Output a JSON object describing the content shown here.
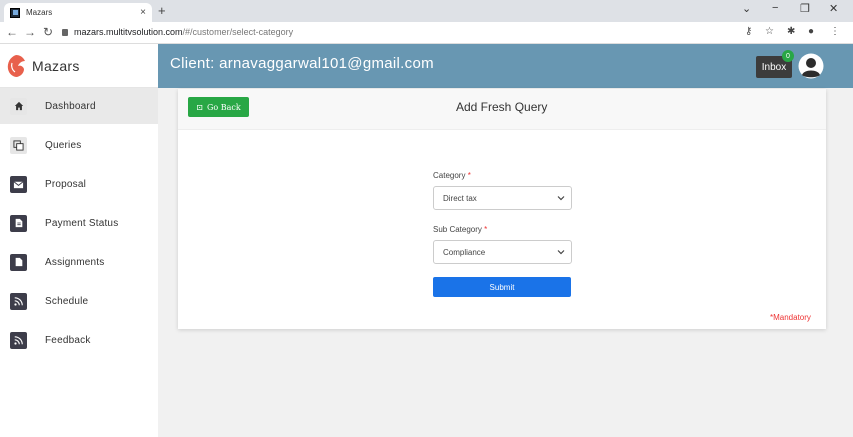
{
  "browser": {
    "tab_title": "Mazars",
    "tab_close": "×",
    "new_tab": "+",
    "url_host": "mazars.multitvsolution.com",
    "url_path": "/#/customer/select-category",
    "win_minimize": "−",
    "win_restore": "❐",
    "win_close": "✕",
    "win_dropdown": "⌄"
  },
  "brand": {
    "name": "Mazars",
    "logo_color": "#e8604c"
  },
  "header": {
    "client_label": "Client: arnavaggarwal101@gmail.com",
    "inbox_label": "Inbox",
    "inbox_count": "0",
    "bar_color": "#6897b2"
  },
  "sidebar": {
    "items": [
      {
        "label": "Dashboard",
        "icon": "home-icon",
        "active": true
      },
      {
        "label": "Queries",
        "icon": "copy-icon",
        "active": false
      },
      {
        "label": "Proposal",
        "icon": "mail-icon",
        "active": false
      },
      {
        "label": "Payment Status",
        "icon": "file-icon",
        "active": false
      },
      {
        "label": "Assignments",
        "icon": "file-icon",
        "active": false
      },
      {
        "label": "Schedule",
        "icon": "rss-icon",
        "active": false
      },
      {
        "label": "Feedback",
        "icon": "rss-icon",
        "active": false
      }
    ]
  },
  "form": {
    "go_back_label": "Go Back",
    "title": "Add Fresh Query",
    "category_label": "Category",
    "category_value": "Direct tax",
    "subcategory_label": "Sub Category",
    "subcategory_value": "Compliance",
    "required_mark": "*",
    "submit_label": "Submit",
    "mandatory_note": "*Mandatory"
  },
  "colors": {
    "accent_green": "#28a745",
    "submit_blue": "#1a73e8",
    "required_red": "#e33333"
  }
}
